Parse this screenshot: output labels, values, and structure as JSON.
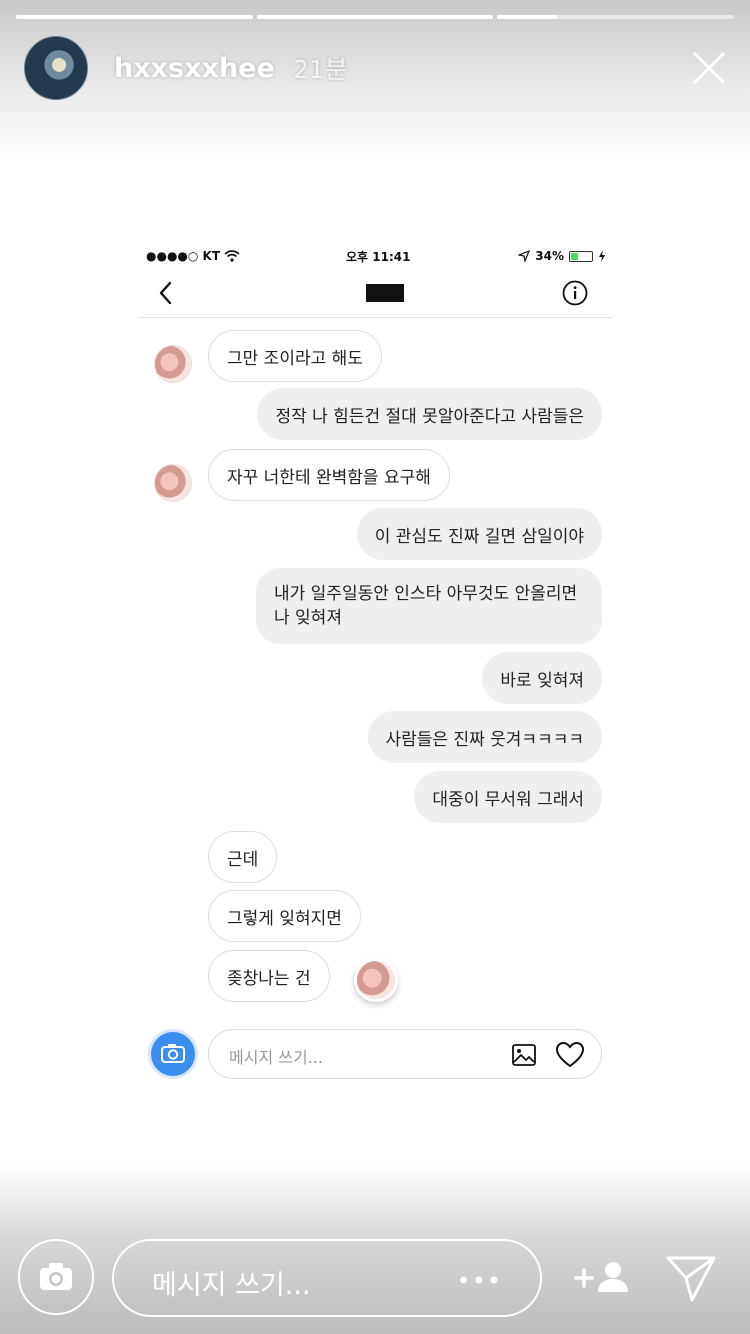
{
  "story": {
    "username": "hxxsxxhee",
    "time": "21분",
    "progress": [
      1.0,
      1.0,
      0.25
    ],
    "reply_placeholder": "메시지 쓰기...",
    "more_label": "•••"
  },
  "dm": {
    "status_bar": {
      "carrier": "●●●●○ KT",
      "time": "오후 11:41",
      "battery": "34%",
      "battery_level": 0.34
    },
    "composer_placeholder": "메시지 쓰기...",
    "messages": [
      {
        "sender": "them",
        "text": "그만 조이라고 해도"
      },
      {
        "sender": "me",
        "text": "정작 나 힘든건 절대 못알아준다고 사람들은"
      },
      {
        "sender": "them",
        "text": "자꾸 너한테 완벽함을 요구해"
      },
      {
        "sender": "me",
        "text": "이 관심도 진짜 길면 삼일이야"
      },
      {
        "sender": "me",
        "text": "내가 일주일동안 인스타 아무것도 안올리면 나 잊혀져"
      },
      {
        "sender": "me",
        "text": "바로 잊혀져"
      },
      {
        "sender": "me",
        "text": "사람들은 진짜 웃겨ㅋㅋㅋㅋ"
      },
      {
        "sender": "me",
        "text": "대중이 무서워 그래서"
      },
      {
        "sender": "them",
        "text": "근데"
      },
      {
        "sender": "them",
        "text": "그렇게 잊혀지면"
      },
      {
        "sender": "them",
        "text": "좆창나는 건"
      }
    ]
  }
}
